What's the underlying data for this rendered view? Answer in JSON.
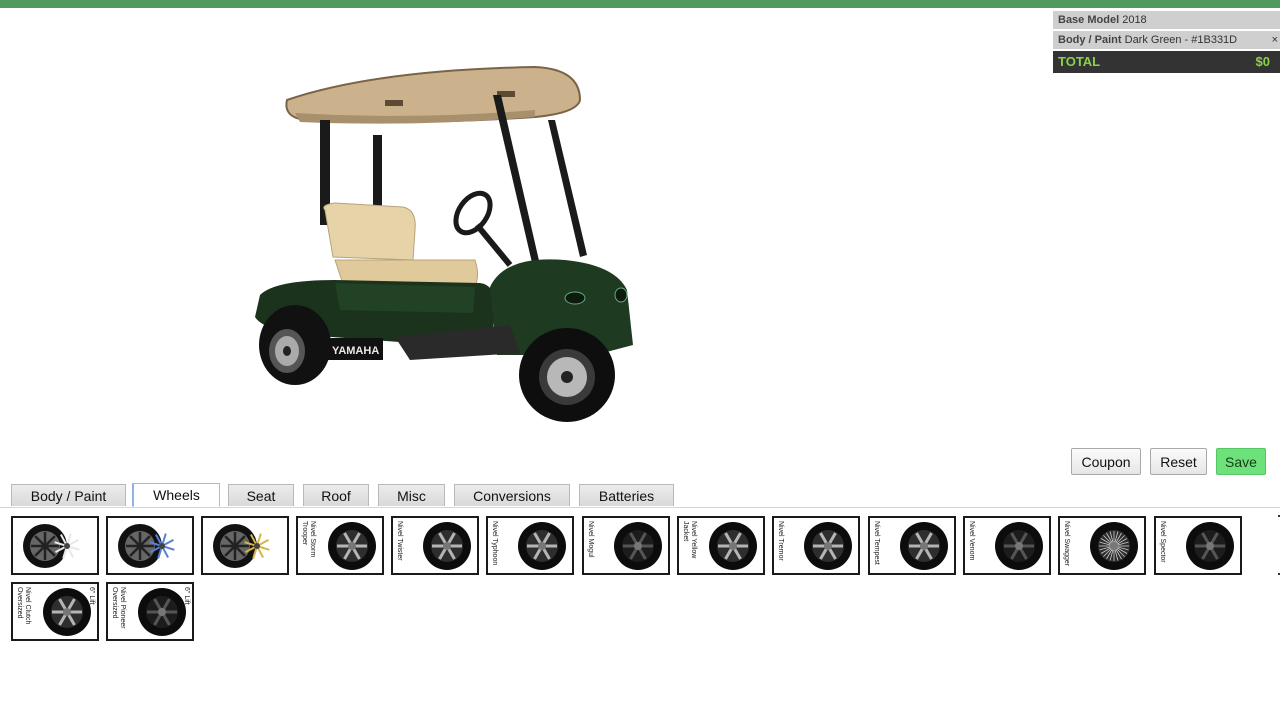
{
  "summary": {
    "base_model_label": "Base Model",
    "base_model_value": "2018",
    "body_paint_label": "Body / Paint",
    "body_paint_value": "Dark Green - #1B331D",
    "remove_glyph": "×",
    "total_label": "TOTAL",
    "total_value": "$0"
  },
  "cart": {
    "brand": "YAMAHA",
    "body_color": "#1B331D"
  },
  "actions": {
    "coupon": "Coupon",
    "reset": "Reset",
    "save": "Save"
  },
  "tabs": [
    "Body / Paint",
    "Wheels",
    "Seat",
    "Roof",
    "Misc",
    "Conversions",
    "Batteries"
  ],
  "active_tab": "Wheels",
  "wheels": [
    {
      "label": "",
      "style": "split-white"
    },
    {
      "label": "",
      "style": "split-blue"
    },
    {
      "label": "",
      "style": "split-gold"
    },
    {
      "label": "Nivel Storm Trooper",
      "style": "tire"
    },
    {
      "label": "Nivel Twister",
      "style": "tire"
    },
    {
      "label": "Nivel Typhoon",
      "style": "tire"
    },
    {
      "label": "Nivel Mogul",
      "style": "tire-dark"
    },
    {
      "label": "Nivel Yellow Jacket",
      "style": "tire"
    },
    {
      "label": "Nivel Tremor",
      "style": "tire"
    },
    {
      "label": "Nivel Tempest",
      "style": "tire"
    },
    {
      "label": "Nivel Venom",
      "style": "tire-dark"
    },
    {
      "label": "Nivel Swagger",
      "style": "tire-mesh"
    },
    {
      "label": "Nivel Spector",
      "style": "tire-dark"
    },
    {
      "label": "Nivel Clutch Oversized",
      "right_label": "6\" Lift",
      "style": "tire-big"
    },
    {
      "label": "Nivel Pioneer Oversized",
      "right_label": "6\" Lift",
      "style": "tire-big-dark"
    }
  ],
  "colors": {
    "accent_green": "#4f9a5c",
    "save_green": "#6de17a",
    "total_text": "#8bd14c"
  }
}
